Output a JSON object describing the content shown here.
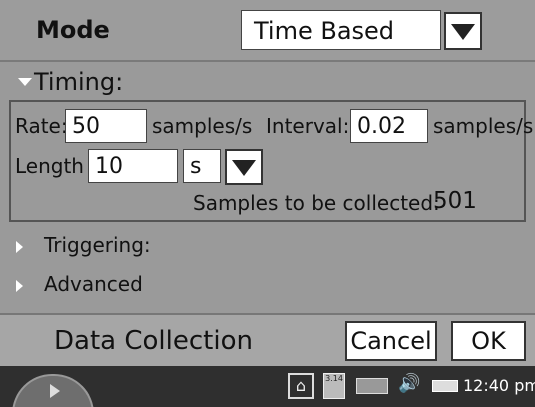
{
  "mode": {
    "label": "Mode",
    "selected": "Time Based"
  },
  "timing": {
    "header": "Timing:",
    "rate_label": "Rate:",
    "rate_value": "50",
    "rate_unit": "samples/s",
    "interval_label": "Interval:",
    "interval_value": "0.02",
    "interval_unit": "samples/s",
    "length_label": "Length",
    "length_value": "10",
    "length_unit": "s",
    "samples_label": "Samples to be collected:",
    "samples_value": "501"
  },
  "sections": {
    "triggering": "Triggering:",
    "advanced": "Advanced"
  },
  "footer": {
    "title": "Data Collection",
    "cancel_label": "Cancel",
    "ok_label": "OK"
  },
  "taskbar": {
    "calc_text": "3.14",
    "clock": "12:40 pm"
  },
  "icons": {
    "start": "play-triangle-icon",
    "home": "home-icon",
    "calculator": "calculator-icon",
    "keyboard": "keyboard-icon",
    "volume": "speaker-icon",
    "battery": "battery-icon"
  }
}
